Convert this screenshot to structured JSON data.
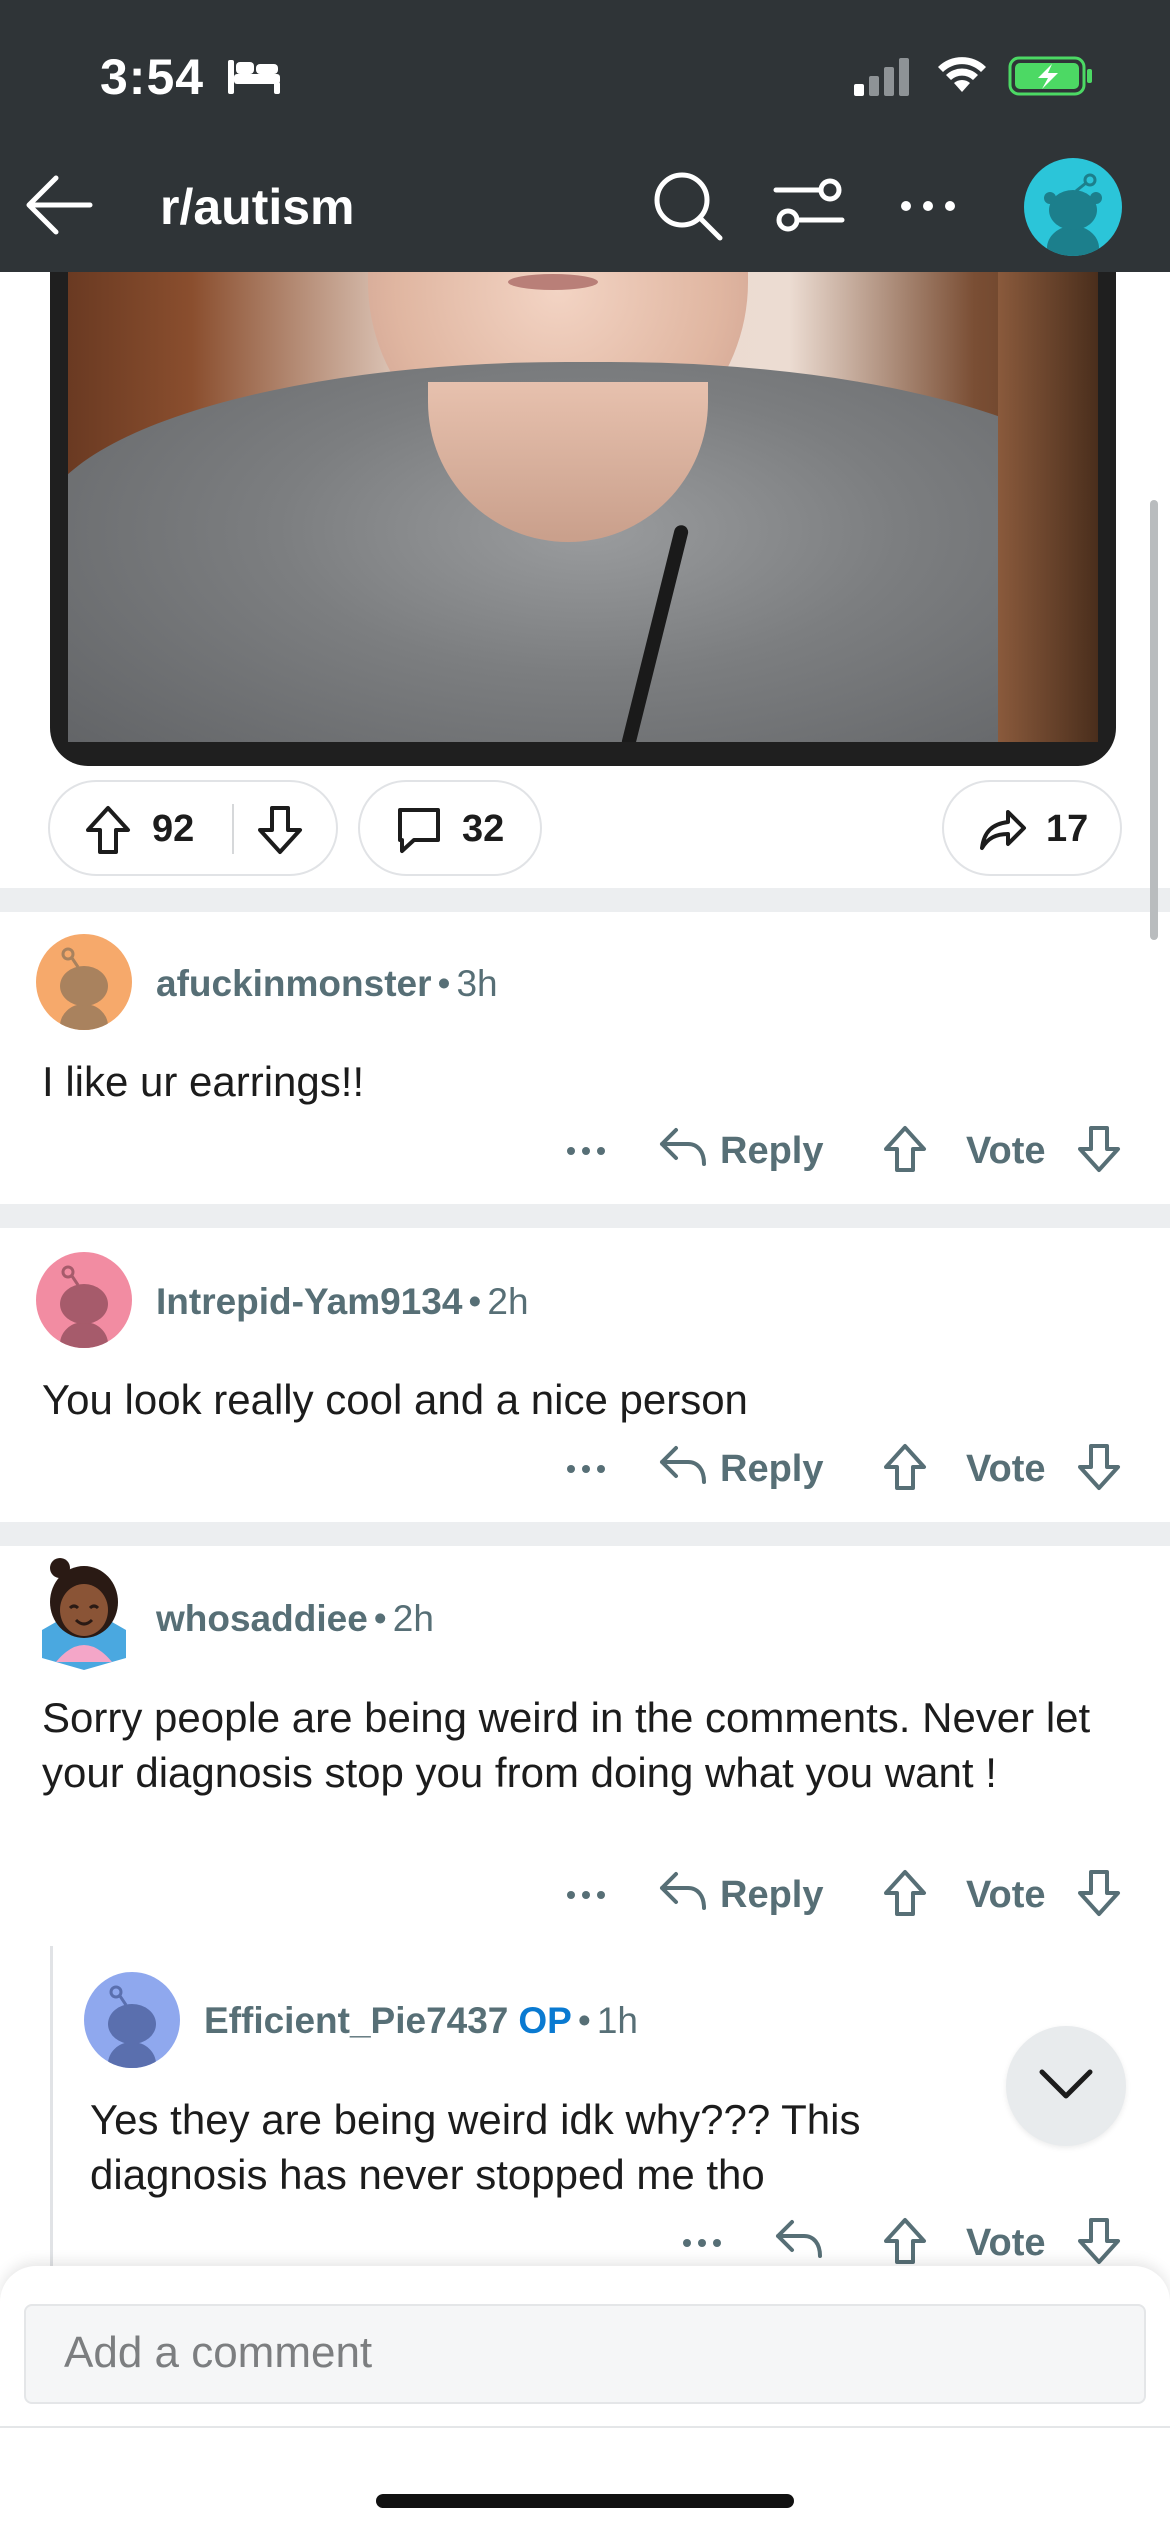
{
  "status_bar": {
    "time": "3:54"
  },
  "header": {
    "subreddit": "r/autism"
  },
  "post_actions": {
    "upvotes": "92",
    "comments": "32",
    "shares": "17"
  },
  "comments": [
    {
      "username": "afuckinmonster",
      "age": "3h",
      "text": "I like ur earrings!!",
      "reply_label": "Reply",
      "vote_label": "Vote",
      "avatar_color": "#f6a96b"
    },
    {
      "username": "Intrepid-Yam9134",
      "age": "2h",
      "text": "You look really cool and a nice person",
      "reply_label": "Reply",
      "vote_label": "Vote",
      "avatar_color": "#f28ca2"
    },
    {
      "username": "whosaddiee",
      "age": "2h",
      "text": "Sorry people are being weird in the comments. Never let your diagnosis stop you from doing what you want !",
      "reply_label": "Reply",
      "vote_label": "Vote"
    },
    {
      "username": "Efficient_Pie7437",
      "op_badge": "OP",
      "age": "1h",
      "text": "Yes they are being weird idk why??? This diagnosis has never stopped me tho",
      "vote_label": "Vote",
      "avatar_color": "#8fa8ee"
    }
  ],
  "composer": {
    "placeholder": "Add a comment"
  },
  "separator": "•",
  "colors": {
    "topbar": "#2f3437",
    "avatar_teal": "#2bc5d9",
    "op_blue": "#0a7ad1",
    "battery_green": "#4cd964"
  }
}
